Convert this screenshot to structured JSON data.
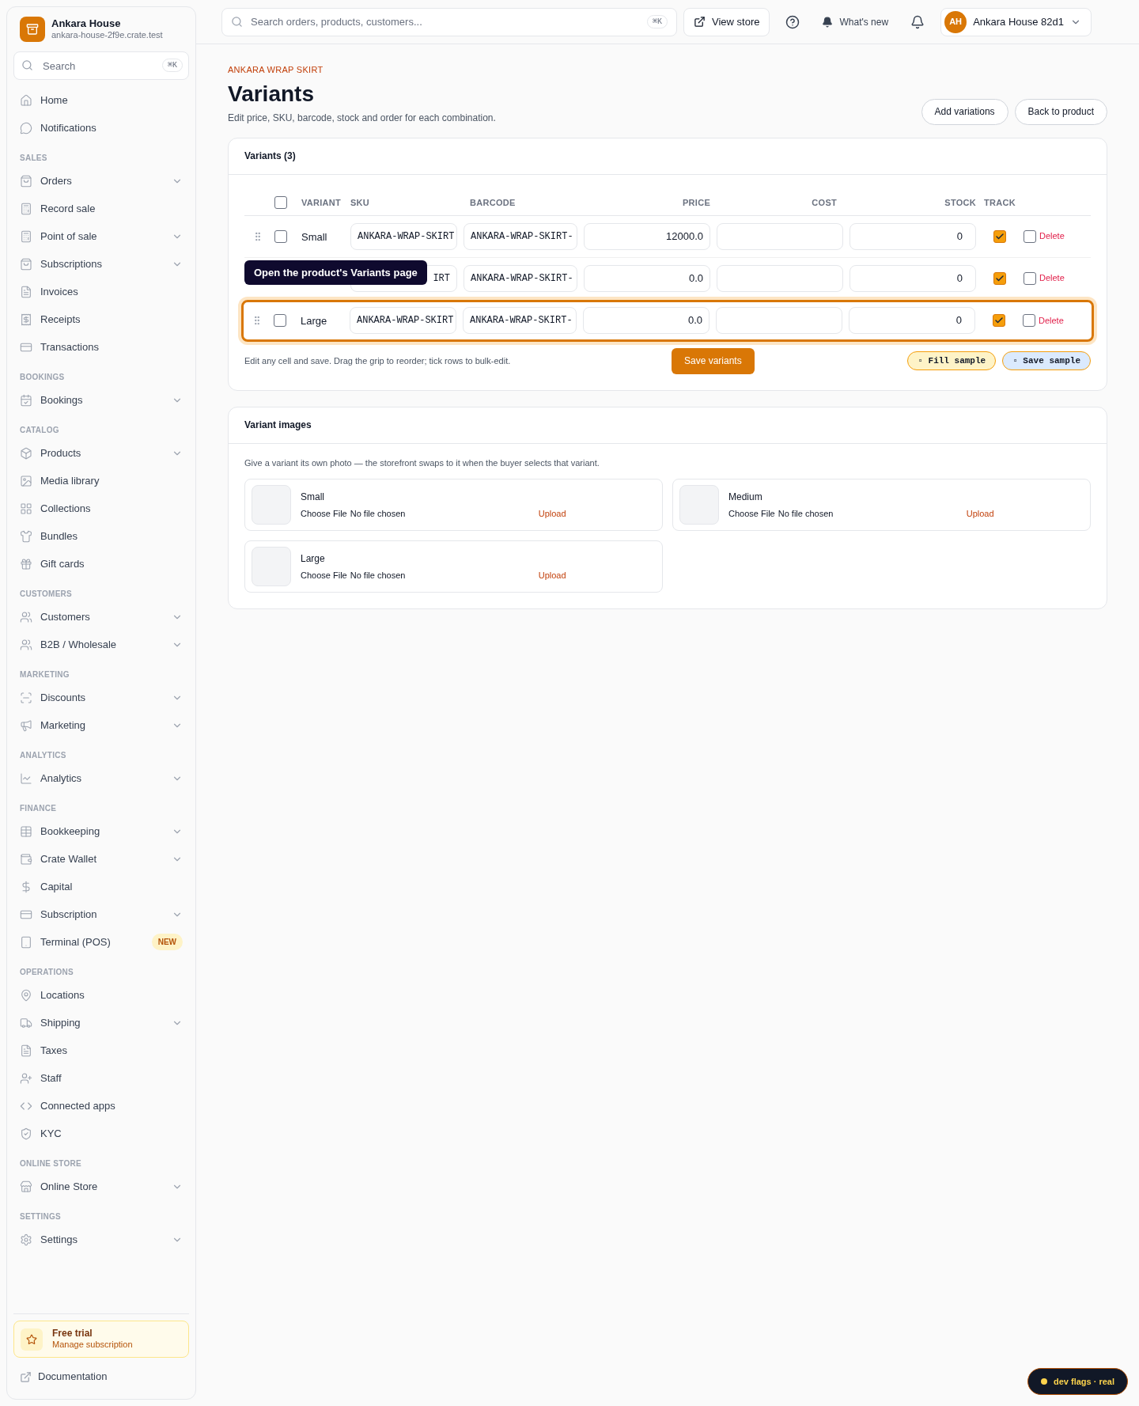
{
  "store": {
    "name": "Ankara House",
    "domain": "ankara-house-2f9e.crate.test",
    "search_placeholder": "Search",
    "search_shortcut": "⌘K"
  },
  "sidebar": {
    "sections": [
      {
        "items": [
          {
            "label": "Home",
            "expandable": false
          },
          {
            "label": "Notifications",
            "expandable": false
          }
        ]
      },
      {
        "title": "SALES",
        "items": [
          {
            "label": "Orders",
            "expandable": true
          },
          {
            "label": "Record sale",
            "expandable": false
          },
          {
            "label": "Point of sale",
            "expandable": true
          },
          {
            "label": "Subscriptions",
            "expandable": true
          },
          {
            "label": "Invoices",
            "expandable": false
          },
          {
            "label": "Receipts",
            "expandable": false
          },
          {
            "label": "Transactions",
            "expandable": false
          }
        ]
      },
      {
        "title": "BOOKINGS",
        "items": [
          {
            "label": "Bookings",
            "expandable": true
          }
        ]
      },
      {
        "title": "CATALOG",
        "items": [
          {
            "label": "Products",
            "expandable": true
          },
          {
            "label": "Media library",
            "expandable": false
          },
          {
            "label": "Collections",
            "expandable": false
          },
          {
            "label": "Bundles",
            "expandable": false
          },
          {
            "label": "Gift cards",
            "expandable": false
          }
        ]
      },
      {
        "title": "CUSTOMERS",
        "items": [
          {
            "label": "Customers",
            "expandable": true
          },
          {
            "label": "B2B / Wholesale",
            "expandable": true
          }
        ]
      },
      {
        "title": "MARKETING",
        "items": [
          {
            "label": "Discounts",
            "expandable": true
          },
          {
            "label": "Marketing",
            "expandable": true
          }
        ]
      },
      {
        "title": "ANALYTICS",
        "items": [
          {
            "label": "Analytics",
            "expandable": true
          }
        ]
      },
      {
        "title": "FINANCE",
        "items": [
          {
            "label": "Bookkeeping",
            "expandable": true
          },
          {
            "label": "Crate Wallet",
            "expandable": true
          },
          {
            "label": "Capital",
            "expandable": false
          },
          {
            "label": "Subscription",
            "expandable": true
          },
          {
            "label": "Terminal (POS)",
            "expandable": false,
            "badge": "NEW"
          }
        ]
      },
      {
        "title": "OPERATIONS",
        "items": [
          {
            "label": "Locations",
            "expandable": false
          },
          {
            "label": "Shipping",
            "expandable": true
          },
          {
            "label": "Taxes",
            "expandable": false
          },
          {
            "label": "Staff",
            "expandable": false
          },
          {
            "label": "Connected apps",
            "expandable": false
          },
          {
            "label": "KYC",
            "expandable": false
          }
        ]
      },
      {
        "title": "ONLINE STORE",
        "items": [
          {
            "label": "Online Store",
            "expandable": true
          }
        ]
      },
      {
        "title": "SETTINGS",
        "items": [
          {
            "label": "Settings",
            "expandable": true
          }
        ]
      }
    ],
    "trial": {
      "title": "Free trial",
      "subtitle": "Manage subscription"
    },
    "documentation": "Documentation"
  },
  "topbar": {
    "search_placeholder": "Search orders, products, customers...",
    "search_shortcut": "⌘K",
    "view_store": "View store",
    "whats_new": "What's new",
    "user": {
      "initials": "AH",
      "name": "Ankara House 82d1"
    }
  },
  "page": {
    "eyebrow": "ANKARA WRAP SKIRT",
    "title": "Variants",
    "subtitle": "Edit price, SKU, barcode, stock and order for each combination.",
    "buttons": [
      "Add variations",
      "Back to product"
    ]
  },
  "variants_card": {
    "title": "Variants (3)",
    "select_all": false,
    "columns": [
      "VARIANT",
      "SKU",
      "BARCODE",
      "PRICE",
      "COST",
      "STOCK",
      "TRACK"
    ],
    "rows": [
      {
        "name": "Small",
        "sku": "ANKARA-WRAP-SKIRT",
        "barcode": "ANKARA-WRAP-SKIRT-",
        "price": "12000.0",
        "stock": "0",
        "selected": false,
        "track": true,
        "delete_checked": false,
        "delete_label": "Delete",
        "highlighted": false
      },
      {
        "sku": "IRT",
        "barcode": "ANKARA-WRAP-SKIRT-",
        "price": "0.0",
        "stock": "0",
        "track": true,
        "delete_checked": false,
        "delete_label": "Delete",
        "highlighted": false,
        "covered": true
      },
      {
        "name": "Large",
        "sku": "ANKARA-WRAP-SKIRT",
        "barcode": "ANKARA-WRAP-SKIRT-",
        "price": "0.0",
        "stock": "0",
        "selected": false,
        "track": true,
        "delete_checked": false,
        "delete_label": "Delete",
        "highlighted": true
      }
    ],
    "tooltip": "Open the product's Variants page",
    "hint": "Edit any cell and save. Drag the grip to reorder; tick rows to bulk-edit.",
    "save": "Save variants",
    "samples": [
      {
        "label": "▫ Fill sample",
        "color": "#fef3c7"
      },
      {
        "label": "▫ Save sample",
        "color": "#dbeafe"
      }
    ]
  },
  "images_card": {
    "title": "Variant images",
    "hint": "Give a variant its own photo — the storefront swaps to it when the buyer selects that variant.",
    "items": [
      {
        "name": "Small",
        "choose": "Choose File",
        "file": "No file chosen",
        "upload": "Upload"
      },
      {
        "name": "Medium",
        "choose": "Choose File",
        "file": "No file chosen",
        "upload": "Upload"
      },
      {
        "name": "Large",
        "choose": "Choose File",
        "file": "No file chosen",
        "upload": "Upload"
      }
    ]
  },
  "dev_flags": "dev flags · real"
}
